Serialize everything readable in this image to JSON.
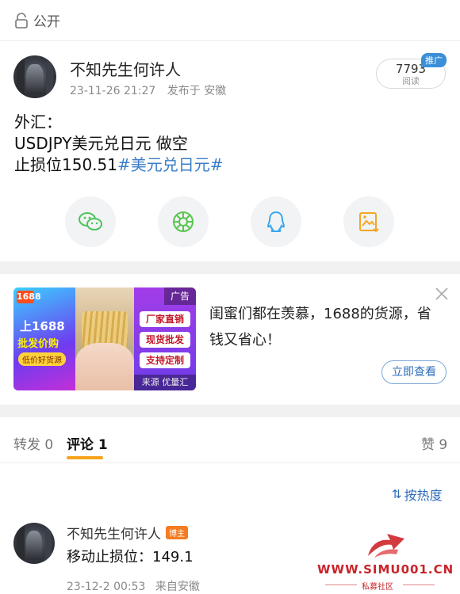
{
  "visibility": {
    "label": "公开"
  },
  "post": {
    "author": "不知先生何许人",
    "timestamp": "23-11-26 21:27",
    "published_at": "发布于 安徽",
    "reads_count": "7793",
    "reads_label": "阅读",
    "promo_badge": "推广",
    "lines": [
      "外汇：",
      "USDJPY美元兑日元 做空",
      "止损位150.51"
    ],
    "hashtag": "#美元兑日元#"
  },
  "share_icons": [
    "wechat-icon",
    "moments-icon",
    "qq-icon",
    "save-image-icon"
  ],
  "ad": {
    "image_text": {
      "brand": "1688",
      "headline": "上1688",
      "subline": "批发价购",
      "pill": "低价好货源",
      "ad_label": "广告",
      "tags": [
        "厂家直销",
        "现货批发",
        "支持定制"
      ],
      "source": "来源 优量汇"
    },
    "text": "闺蜜们都在羡慕，1688的货源，省钱又省心！",
    "cta": "立即查看"
  },
  "tabs": {
    "repost": "转发 0",
    "comments": "评论 1",
    "likes": "赞 9"
  },
  "sort_label": "按热度",
  "comment": {
    "author": "不知先生何许人",
    "badge": "博主",
    "text": "移动止损位：149.1",
    "timestamp": "23-12-2 00:53",
    "source": "来自安徽"
  },
  "watermark": {
    "site": "WWW.SIMU001.CN",
    "sub": "私募社区"
  },
  "colors": {
    "link": "#3a7dc8",
    "tab_accent": "#f7a21b",
    "badge": "#f57c21",
    "watermark": "#c8242a"
  }
}
